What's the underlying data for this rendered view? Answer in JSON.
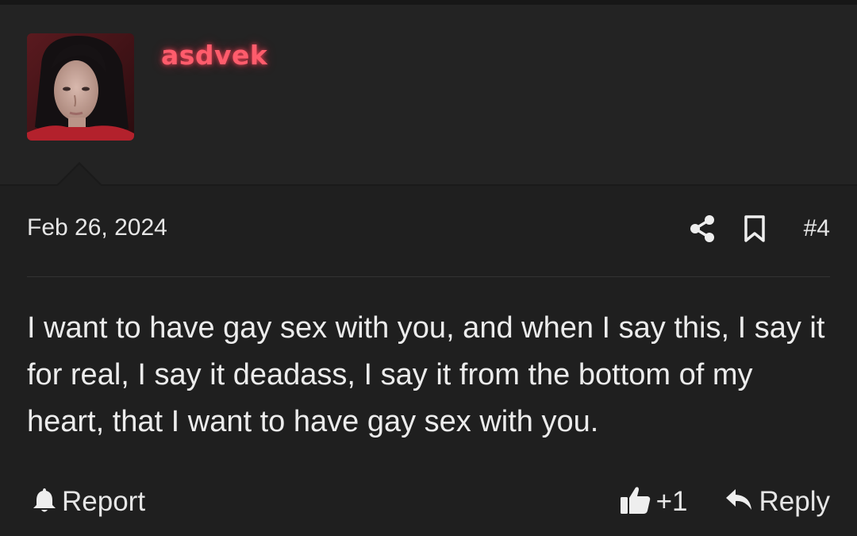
{
  "post": {
    "author": {
      "username": "asdvek",
      "username_color": "#ff5c6c",
      "avatar_icon": "user-avatar-photo"
    },
    "date": "Feb 26, 2024",
    "number": "#4",
    "body": "I want to have gay sex with you, and when I say this, I say it for real, I say it deadass, I say it from the bottom of my heart, that I want to have gay sex with you.",
    "actions": {
      "share_icon": "share-icon",
      "bookmark_icon": "bookmark-icon"
    },
    "footer": {
      "report_label": "Report",
      "report_icon": "bell-icon",
      "like_icon": "thumbs-up-icon",
      "like_count": "+1",
      "reply_icon": "reply-arrow-icon",
      "reply_label": "Reply"
    }
  },
  "colors": {
    "background": "#1f1f1f",
    "header_background": "#232323",
    "text": "#e6e6e6",
    "username_glow": "#ff4660"
  }
}
